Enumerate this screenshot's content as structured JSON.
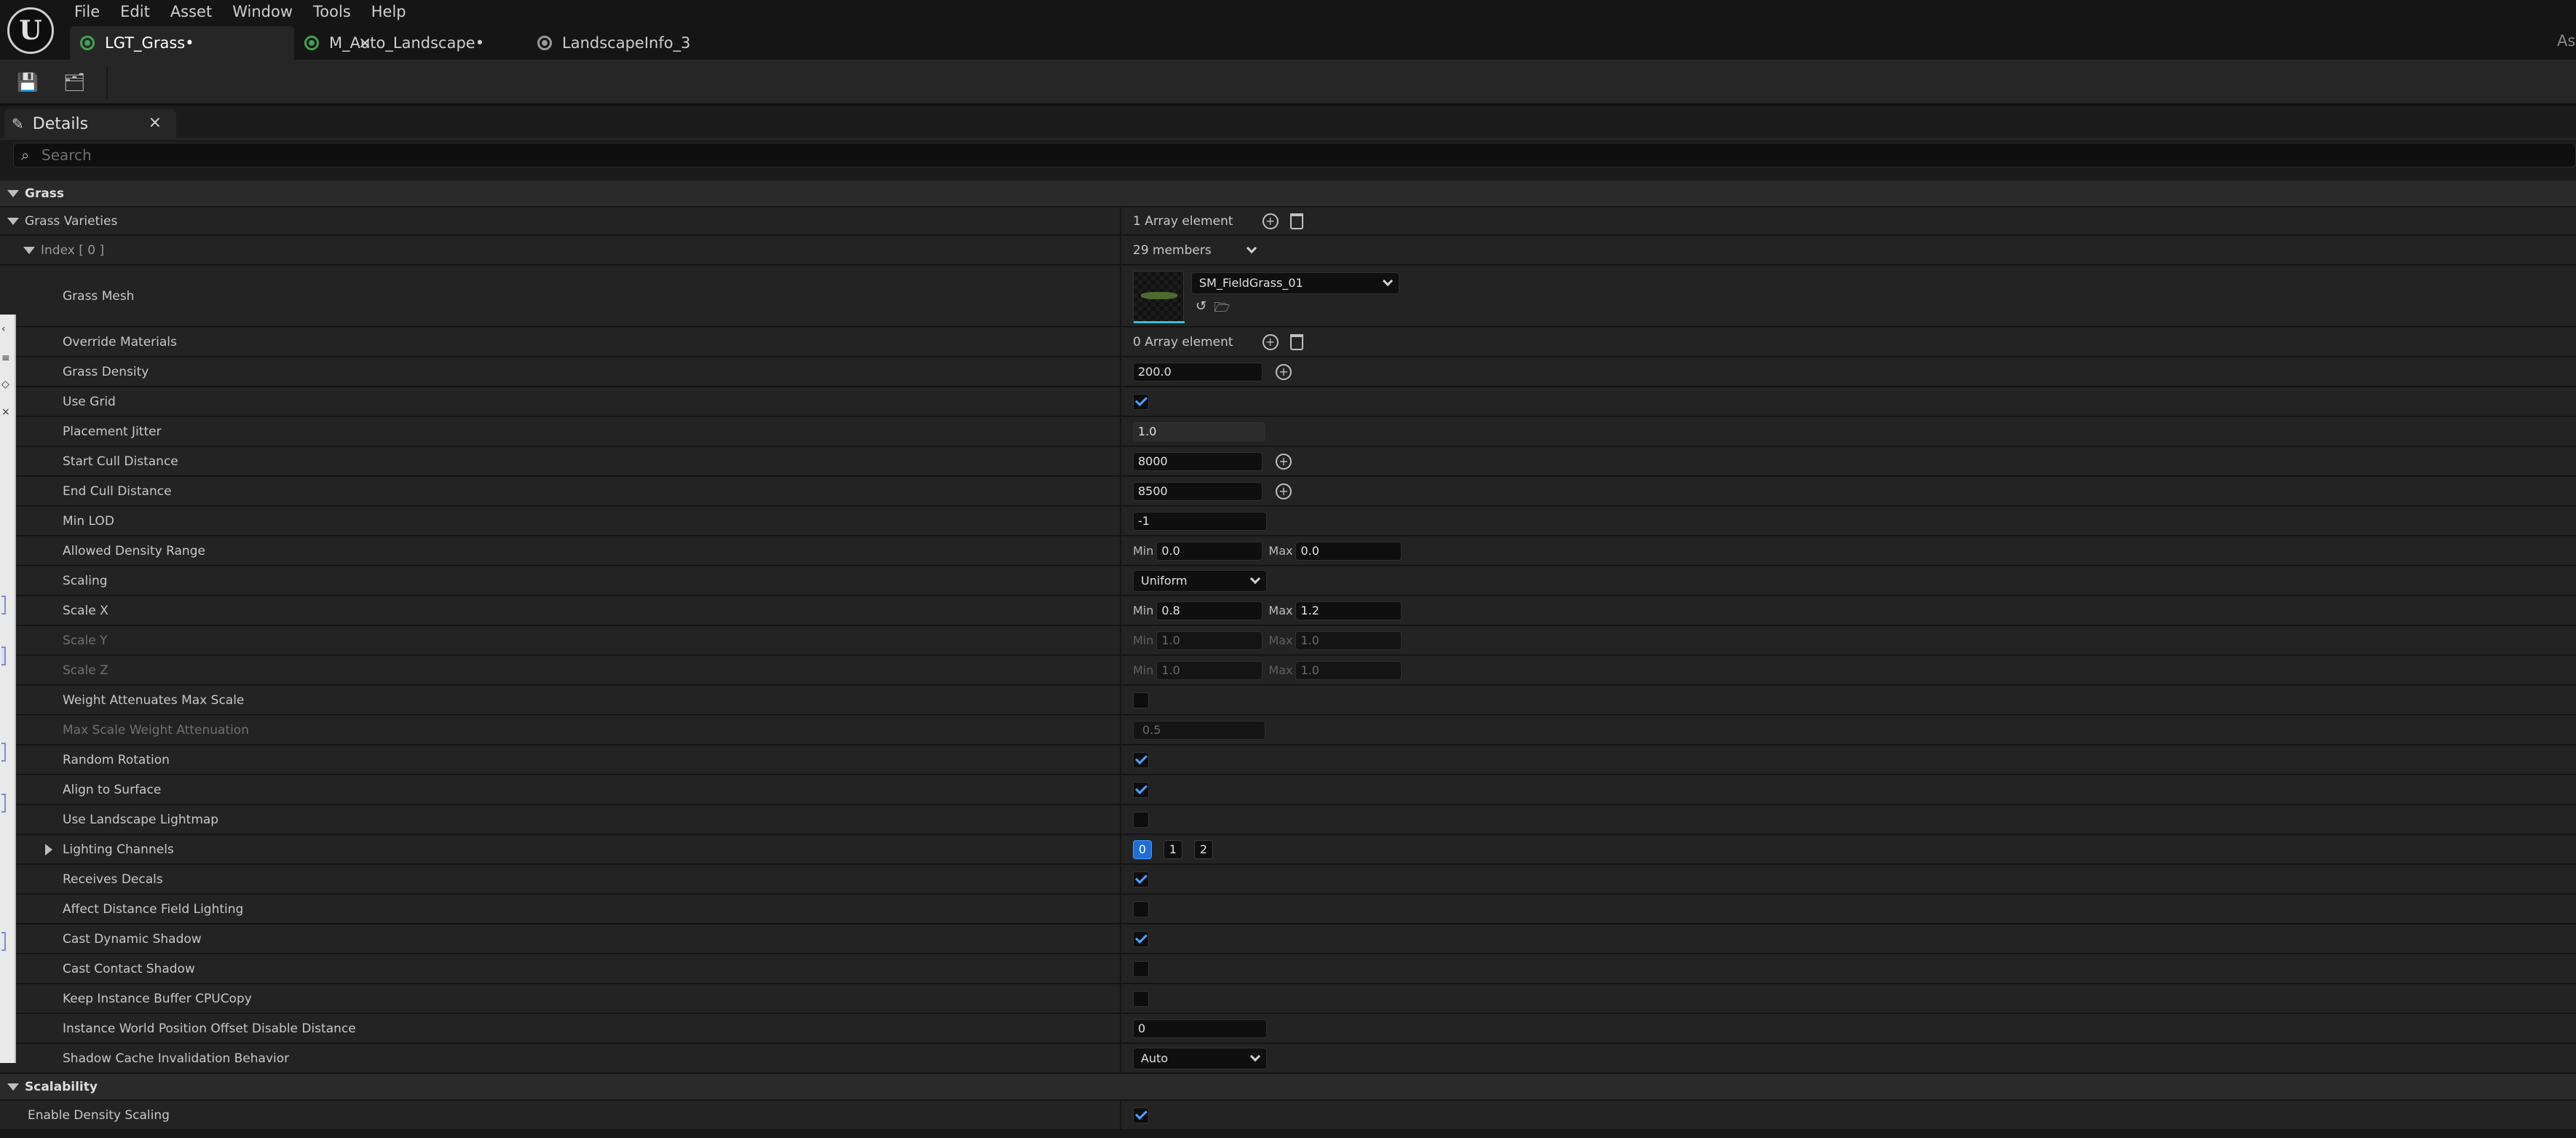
{
  "app": {
    "logo_letter": "U",
    "menu": [
      "File",
      "Edit",
      "Asset",
      "Window",
      "Tools",
      "Help"
    ],
    "tabs": [
      {
        "label": "LGT_Grass•",
        "active": true,
        "close": "×"
      },
      {
        "label": "M_Auto_Landscape•",
        "active": false
      },
      {
        "label": "LandscapeInfo_3",
        "active": false
      }
    ],
    "right_cut_text": "As"
  },
  "toolbar": {
    "save_icon": "💾",
    "browse_icon": "🗂"
  },
  "details": {
    "tab_label": "Details",
    "tab_icon": "✎",
    "tab_close": "×",
    "search_placeholder": "Search",
    "search_icon": "⌕"
  },
  "sections": {
    "grass": "Grass",
    "grass_varieties": "Grass Varieties",
    "grass_varieties_count": "1 Array element",
    "index": "Index [ 0 ]",
    "index_members": "29 members",
    "scalability": "Scalability"
  },
  "props": {
    "grass_mesh": {
      "label": "Grass Mesh",
      "value": "SM_FieldGrass_01"
    },
    "override_materials": {
      "label": "Override Materials",
      "value": "0 Array element"
    },
    "grass_density": {
      "label": "Grass Density",
      "value": "200.0"
    },
    "use_grid": {
      "label": "Use Grid",
      "checked": true
    },
    "placement_jitter": {
      "label": "Placement Jitter",
      "value": "1.0"
    },
    "start_cull_distance": {
      "label": "Start Cull Distance",
      "value": "8000"
    },
    "end_cull_distance": {
      "label": "End Cull Distance",
      "value": "8500"
    },
    "min_lod": {
      "label": "Min LOD",
      "value": "-1"
    },
    "allowed_density_range": {
      "label": "Allowed Density Range",
      "min_label": "Min",
      "min": "0.0",
      "max_label": "Max",
      "max": "0.0"
    },
    "scaling": {
      "label": "Scaling",
      "value": "Uniform"
    },
    "scale_x": {
      "label": "Scale X",
      "min_label": "Min",
      "min": "0.8",
      "max_label": "Max",
      "max": "1.2"
    },
    "scale_y": {
      "label": "Scale Y",
      "min_label": "Min",
      "min": "1.0",
      "max_label": "Max",
      "max": "1.0"
    },
    "scale_z": {
      "label": "Scale Z",
      "min_label": "Min",
      "min": "1.0",
      "max_label": "Max",
      "max": "1.0"
    },
    "weight_attenuates_max_scale": {
      "label": "Weight Attenuates Max Scale",
      "checked": false
    },
    "max_scale_weight_attenuation": {
      "label": "Max Scale Weight Attenuation",
      "value": "0.5"
    },
    "random_rotation": {
      "label": "Random Rotation",
      "checked": true
    },
    "align_to_surface": {
      "label": "Align to Surface",
      "checked": true
    },
    "use_landscape_lightmap": {
      "label": "Use Landscape Lightmap",
      "checked": false
    },
    "lighting_channels": {
      "label": "Lighting Channels",
      "channels": [
        "0",
        "1",
        "2"
      ]
    },
    "receives_decals": {
      "label": "Receives Decals",
      "checked": true
    },
    "affect_distance_field_lighting": {
      "label": "Affect Distance Field Lighting",
      "checked": false
    },
    "cast_dynamic_shadow": {
      "label": "Cast Dynamic Shadow",
      "checked": true
    },
    "cast_contact_shadow": {
      "label": "Cast Contact Shadow",
      "checked": false
    },
    "keep_instance_buffer_cpucopy": {
      "label": "Keep Instance Buffer CPUCopy",
      "checked": false
    },
    "instance_wpo_disable_distance": {
      "label": "Instance World Position Offset Disable Distance",
      "value": "0"
    },
    "shadow_cache_invalidation_behavior": {
      "label": "Shadow Cache Invalidation Behavior",
      "value": "Auto"
    },
    "enable_density_scaling": {
      "label": "Enable Density Scaling",
      "checked": true
    }
  },
  "icons": {
    "add": "+",
    "reset": "↺",
    "browse": "🗁"
  },
  "colors": {
    "accent_blue": "#1d6fd6",
    "check_blue": "#4ea3ff",
    "asset_green": "#3fa34d"
  }
}
